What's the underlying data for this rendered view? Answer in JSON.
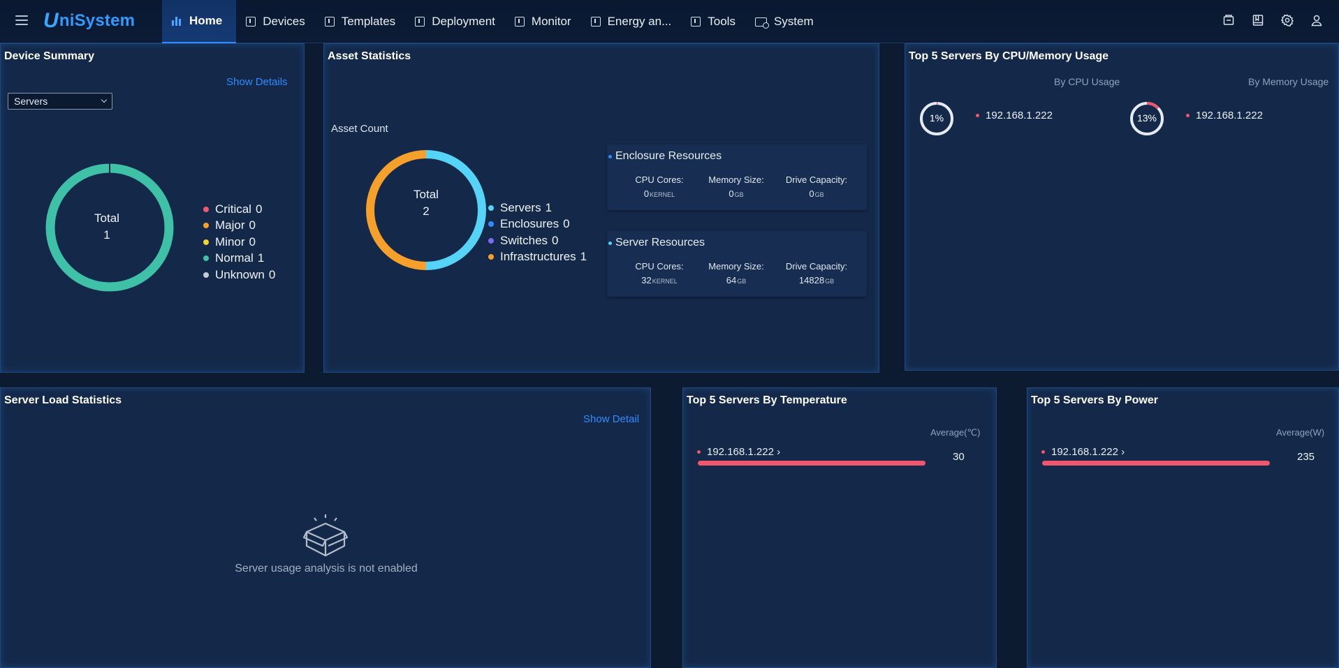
{
  "app": {
    "logo_u": "U",
    "logo_rest": "niSystem"
  },
  "nav": {
    "home": "Home",
    "devices": "Devices",
    "templates": "Templates",
    "deployment": "Deployment",
    "monitor": "Monitor",
    "energy": "Energy an...",
    "tools": "Tools",
    "system": "System"
  },
  "colors": {
    "critical": "#ee5b6f",
    "major": "#f6a02c",
    "minor": "#f1d432",
    "normal": "#3fc1a8",
    "unknown": "#c4cad4",
    "servers": "#55d4f7",
    "enclosures": "#2f8cff",
    "switches": "#7a6bf2",
    "infrastructures": "#f6a02c",
    "accent": "#2e8cff",
    "bar": "#f0566e"
  },
  "device_summary": {
    "title": "Device Summary",
    "show_details": "Show Details",
    "select_value": "Servers",
    "total_label": "Total",
    "total_value": "1",
    "legend": [
      {
        "label": "Critical",
        "value": "0",
        "color": "#ee5b6f"
      },
      {
        "label": "Major",
        "value": "0",
        "color": "#f6a02c"
      },
      {
        "label": "Minor",
        "value": "0",
        "color": "#f1d432"
      },
      {
        "label": "Normal",
        "value": "1",
        "color": "#3fc1a8"
      },
      {
        "label": "Unknown",
        "value": "0",
        "color": "#c4cad4"
      }
    ]
  },
  "asset_statistics": {
    "title": "Asset Statistics",
    "subtitle": "Asset Count",
    "total_label": "Total",
    "total_value": "2",
    "legend": [
      {
        "label": "Servers",
        "value": "1",
        "color": "#55d4f7"
      },
      {
        "label": "Enclosures",
        "value": "0",
        "color": "#2f8cff"
      },
      {
        "label": "Switches",
        "value": "0",
        "color": "#7a6bf2"
      },
      {
        "label": "Infrastructures",
        "value": "1",
        "color": "#f6a02c"
      }
    ],
    "enclosure": {
      "title": "Enclosure Resources",
      "cpu_label": "CPU Cores:",
      "cpu_value": "0",
      "cpu_unit": "KERNEL",
      "mem_label": "Memory Size:",
      "mem_value": "0",
      "mem_unit": "GB",
      "drive_label": "Drive Capacity:",
      "drive_value": "0",
      "drive_unit": "GB"
    },
    "server": {
      "title": "Server Resources",
      "cpu_label": "CPU Cores:",
      "cpu_value": "32",
      "cpu_unit": "KERNEL",
      "mem_label": "Memory Size:",
      "mem_value": "64",
      "mem_unit": "GB",
      "drive_label": "Drive Capacity:",
      "drive_value": "14828",
      "drive_unit": "GB"
    }
  },
  "top_cpu_mem": {
    "title": "Top 5 Servers By CPU/Memory Usage",
    "cpu_label": "By CPU Usage",
    "mem_label": "By Memory Usage",
    "cpu": {
      "percent_text": "1%",
      "fraction": 0.01,
      "ip": "192.168.1.222"
    },
    "mem": {
      "percent_text": "13%",
      "fraction": 0.13,
      "ip": "192.168.1.222"
    }
  },
  "server_load": {
    "title": "Server Load Statistics",
    "show_detail": "Show Detail",
    "empty_text": "Server usage analysis is not enabled"
  },
  "top_temperature": {
    "title": "Top 5 Servers By Temperature",
    "avg_label": "Average(℃)",
    "ip": "192.168.1.222 ›",
    "value": "30"
  },
  "top_power": {
    "title": "Top 5 Servers By Power",
    "avg_label": "Average(W)",
    "ip": "192.168.1.222 ›",
    "value": "235"
  }
}
